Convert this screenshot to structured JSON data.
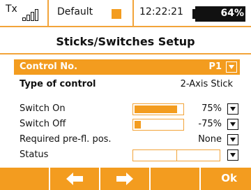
{
  "status_bar": {
    "tx_label": "Tx",
    "model_name": "Default",
    "time": "12:22:21",
    "battery_percent": "64%"
  },
  "title": "Sticks/Switches Setup",
  "control": {
    "label": "Control No.",
    "value": "P1"
  },
  "type_of_control": {
    "label": "Type of control",
    "value": "2-Axis Stick"
  },
  "rows": {
    "switch_on": {
      "label": "Switch On",
      "value": "75%",
      "bar_fill": 0.87
    },
    "switch_off": {
      "label": "Switch Off",
      "value": "-75%",
      "bar_fill": 0.13
    },
    "required_pos": {
      "label": "Required pre-fl. pos.",
      "value": "None"
    },
    "status": {
      "label": "Status"
    }
  },
  "softkeys": {
    "ok_label": "Ok"
  },
  "colors": {
    "accent": "#f39c1f",
    "border": "#f2a43a"
  }
}
